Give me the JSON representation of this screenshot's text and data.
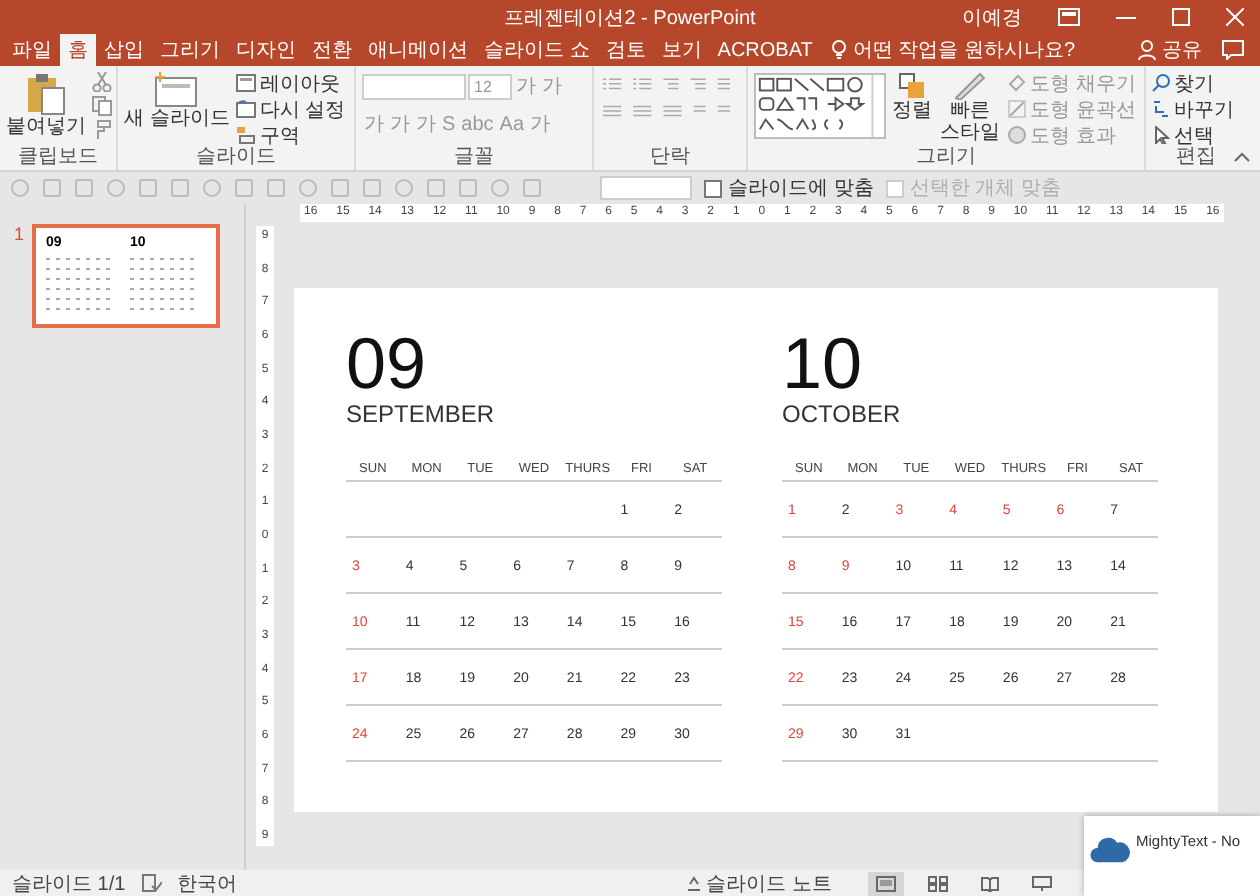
{
  "window": {
    "title": "프레젠테이션2 - PowerPoint",
    "user": "이예경"
  },
  "tabs": [
    {
      "label": "파일",
      "selected": false
    },
    {
      "label": "홈",
      "selected": true
    },
    {
      "label": "삽입",
      "selected": false
    },
    {
      "label": "그리기",
      "selected": false
    },
    {
      "label": "디자인",
      "selected": false
    },
    {
      "label": "전환",
      "selected": false
    },
    {
      "label": "애니메이션",
      "selected": false
    },
    {
      "label": "슬라이드 쇼",
      "selected": false
    },
    {
      "label": "검토",
      "selected": false
    },
    {
      "label": "보기",
      "selected": false
    },
    {
      "label": "ACROBAT",
      "selected": false
    }
  ],
  "tell_me": {
    "placeholder": "어떤 작업을 원하시나요?"
  },
  "share": "공유",
  "ribbon": {
    "clipboard": {
      "label": "클립보드",
      "paste": "붙여넣기"
    },
    "slides": {
      "label": "슬라이드",
      "new_slide": "새 슬라이드",
      "layout": "레이아웃",
      "reset": "다시 설정",
      "section": "구역"
    },
    "font": {
      "label": "글꼴",
      "size": "12",
      "size_buttons": [
        "가",
        "가"
      ],
      "format_buttons": [
        "가",
        "가",
        "가",
        "S",
        "abc",
        "Aa",
        "가"
      ]
    },
    "paragraph": {
      "label": "단락"
    },
    "drawing": {
      "label": "그리기",
      "arrange": "정렬",
      "quick_styles": "빠른 스타일",
      "fill": "도형 채우기",
      "outline": "도형 윤곽선",
      "effects": "도형 효과"
    },
    "editing": {
      "label": "편집",
      "find": "찾기",
      "replace": "바꾸기",
      "select": "선택"
    }
  },
  "view_bar": {
    "fit_to_slide": {
      "label": "슬라이드에 맞춤",
      "checked": false
    },
    "fit_selection": {
      "label": "선택한 개체 맞춤",
      "disabled": true
    }
  },
  "ruler": {
    "horizontal": [
      "16",
      "15",
      "14",
      "13",
      "12",
      "11",
      "10",
      "9",
      "8",
      "7",
      "6",
      "5",
      "4",
      "3",
      "2",
      "1",
      "0",
      "1",
      "2",
      "3",
      "4",
      "5",
      "6",
      "7",
      "8",
      "9",
      "10",
      "11",
      "12",
      "13",
      "14",
      "15",
      "16"
    ],
    "vertical": [
      "9",
      "8",
      "7",
      "6",
      "5",
      "4",
      "3",
      "2",
      "1",
      "0",
      "1",
      "2",
      "3",
      "4",
      "5",
      "6",
      "7",
      "8",
      "9"
    ]
  },
  "thumbnails": [
    {
      "number": "1",
      "selected": true,
      "titles": [
        "09",
        "10"
      ]
    }
  ],
  "slide": {
    "months": [
      {
        "number": "09",
        "name": "SEPTEMBER",
        "weekdays": [
          "SUN",
          "MON",
          "TUE",
          "WED",
          "THURS",
          "FRI",
          "SAT"
        ],
        "weeks": [
          {
            "kind": "trailing",
            "days": [
              {
                "day": "1",
                "holiday": false
              },
              {
                "day": "2",
                "holiday": false
              }
            ]
          },
          {
            "kind": "full",
            "days": [
              {
                "day": "3",
                "holiday": true
              },
              {
                "day": "4",
                "holiday": false
              },
              {
                "day": "5",
                "holiday": false
              },
              {
                "day": "6",
                "holiday": false
              },
              {
                "day": "7",
                "holiday": false
              },
              {
                "day": "8",
                "holiday": false
              },
              {
                "day": "9",
                "holiday": false
              }
            ]
          },
          {
            "kind": "full",
            "days": [
              {
                "day": "10",
                "holiday": true
              },
              {
                "day": "11",
                "holiday": false
              },
              {
                "day": "12",
                "holiday": false
              },
              {
                "day": "13",
                "holiday": false
              },
              {
                "day": "14",
                "holiday": false
              },
              {
                "day": "15",
                "holiday": false
              },
              {
                "day": "16",
                "holiday": false
              }
            ]
          },
          {
            "kind": "full",
            "days": [
              {
                "day": "17",
                "holiday": true
              },
              {
                "day": "18",
                "holiday": false
              },
              {
                "day": "19",
                "holiday": false
              },
              {
                "day": "20",
                "holiday": false
              },
              {
                "day": "21",
                "holiday": false
              },
              {
                "day": "22",
                "holiday": false
              },
              {
                "day": "23",
                "holiday": false
              }
            ]
          },
          {
            "kind": "full",
            "days": [
              {
                "day": "24",
                "holiday": true
              },
              {
                "day": "25",
                "holiday": false
              },
              {
                "day": "26",
                "holiday": false
              },
              {
                "day": "27",
                "holiday": false
              },
              {
                "day": "28",
                "holiday": false
              },
              {
                "day": "29",
                "holiday": false
              },
              {
                "day": "30",
                "holiday": false
              }
            ]
          }
        ]
      },
      {
        "number": "10",
        "name": "OCTOBER",
        "weekdays": [
          "SUN",
          "MON",
          "TUE",
          "WED",
          "THURS",
          "FRI",
          "SAT"
        ],
        "weeks": [
          {
            "kind": "full",
            "days": [
              {
                "day": "1",
                "holiday": true
              },
              {
                "day": "2",
                "holiday": false
              },
              {
                "day": "3",
                "holiday": true
              },
              {
                "day": "4",
                "holiday": true
              },
              {
                "day": "5",
                "holiday": true
              },
              {
                "day": "6",
                "holiday": true
              },
              {
                "day": "7",
                "holiday": false
              }
            ]
          },
          {
            "kind": "full",
            "days": [
              {
                "day": "8",
                "holiday": true
              },
              {
                "day": "9",
                "holiday": true
              },
              {
                "day": "10",
                "holiday": false
              },
              {
                "day": "11",
                "holiday": false
              },
              {
                "day": "12",
                "holiday": false
              },
              {
                "day": "13",
                "holiday": false
              },
              {
                "day": "14",
                "holiday": false
              }
            ]
          },
          {
            "kind": "full",
            "days": [
              {
                "day": "15",
                "holiday": true
              },
              {
                "day": "16",
                "holiday": false
              },
              {
                "day": "17",
                "holiday": false
              },
              {
                "day": "18",
                "holiday": false
              },
              {
                "day": "19",
                "holiday": false
              },
              {
                "day": "20",
                "holiday": false
              },
              {
                "day": "21",
                "holiday": false
              }
            ]
          },
          {
            "kind": "full",
            "days": [
              {
                "day": "22",
                "holiday": true
              },
              {
                "day": "23",
                "holiday": false
              },
              {
                "day": "24",
                "holiday": false
              },
              {
                "day": "25",
                "holiday": false
              },
              {
                "day": "26",
                "holiday": false
              },
              {
                "day": "27",
                "holiday": false
              },
              {
                "day": "28",
                "holiday": false
              }
            ]
          },
          {
            "kind": "leading",
            "days": [
              {
                "day": "29",
                "holiday": true
              },
              {
                "day": "30",
                "holiday": false
              },
              {
                "day": "31",
                "holiday": false
              }
            ]
          }
        ]
      }
    ]
  },
  "status_bar": {
    "slide": "슬라이드 1/1",
    "language": "한국어",
    "notes": "슬라이드 노트",
    "views": [
      {
        "kind": "normal",
        "selected": true
      },
      {
        "kind": "sorter",
        "selected": false
      },
      {
        "kind": "reading",
        "selected": false
      },
      {
        "kind": "show",
        "selected": false
      }
    ]
  },
  "notification": {
    "title": "MightyText - No"
  }
}
